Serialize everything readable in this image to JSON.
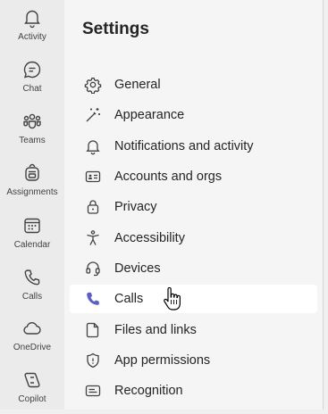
{
  "app_rail": {
    "items": [
      {
        "label": "Activity",
        "icon": "bell-icon"
      },
      {
        "label": "Chat",
        "icon": "chat-icon"
      },
      {
        "label": "Teams",
        "icon": "teams-icon"
      },
      {
        "label": "Assignments",
        "icon": "backpack-icon"
      },
      {
        "label": "Calendar",
        "icon": "calendar-icon"
      },
      {
        "label": "Calls",
        "icon": "phone-icon"
      },
      {
        "label": "OneDrive",
        "icon": "cloud-icon"
      },
      {
        "label": "Copilot",
        "icon": "copilot-icon"
      }
    ]
  },
  "settings": {
    "title": "Settings",
    "selected": "Calls",
    "accent_color": "#5b5fc7",
    "items": [
      {
        "label": "General",
        "icon": "gear-icon"
      },
      {
        "label": "Appearance",
        "icon": "magic-wand-icon"
      },
      {
        "label": "Notifications and activity",
        "icon": "bell-icon"
      },
      {
        "label": "Accounts and orgs",
        "icon": "id-card-icon"
      },
      {
        "label": "Privacy",
        "icon": "lock-icon"
      },
      {
        "label": "Accessibility",
        "icon": "accessibility-icon"
      },
      {
        "label": "Devices",
        "icon": "headset-icon"
      },
      {
        "label": "Calls",
        "icon": "phone-icon"
      },
      {
        "label": "Files and links",
        "icon": "document-icon"
      },
      {
        "label": "App permissions",
        "icon": "shield-icon"
      },
      {
        "label": "Recognition",
        "icon": "captions-icon"
      }
    ]
  }
}
